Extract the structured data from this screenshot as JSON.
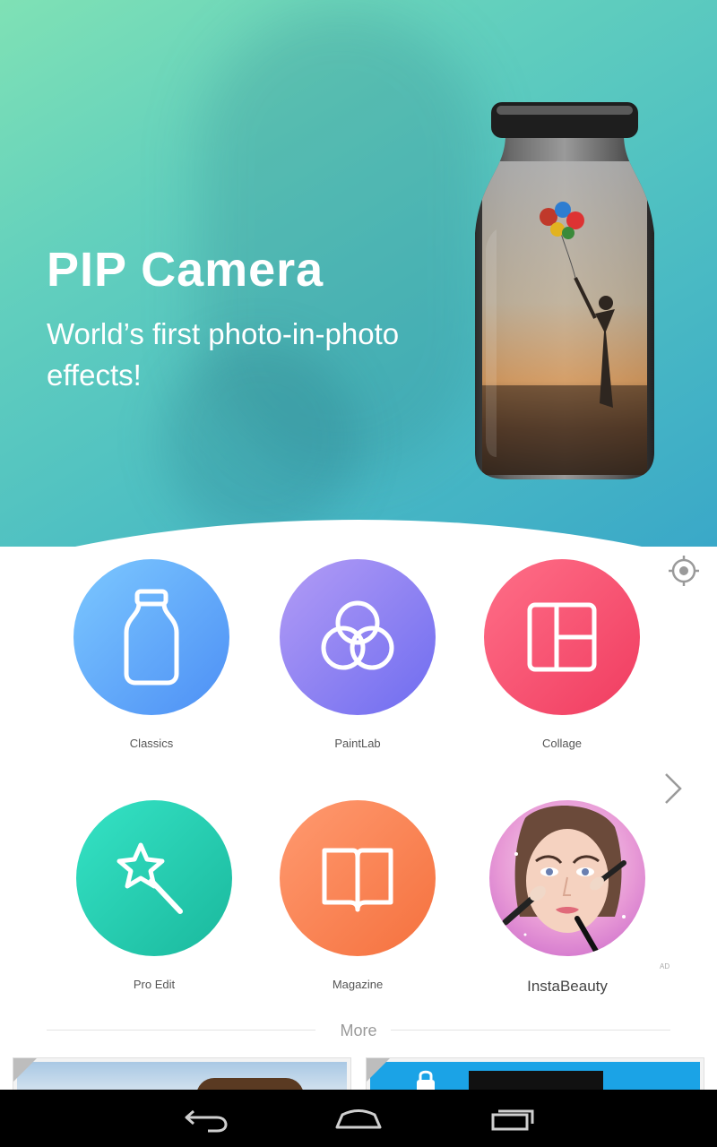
{
  "hero": {
    "title": "PIP Camera",
    "subtitle": "World’s first photo-in-photo effects!"
  },
  "features": [
    {
      "label": "Classics",
      "icon": "bottle-icon",
      "color_from": "#7cc8ff",
      "color_to": "#4d8ff5"
    },
    {
      "label": "PaintLab",
      "icon": "circles-icon",
      "color_from": "#b39cf5",
      "color_to": "#6e6cf0"
    },
    {
      "label": "Collage",
      "icon": "collage-grid-icon",
      "color_from": "#ff6f88",
      "color_to": "#f03c60"
    },
    {
      "label": "Pro Edit",
      "icon": "magic-wand-icon",
      "color_from": "#35e3c5",
      "color_to": "#1ab89d"
    },
    {
      "label": "Magazine",
      "icon": "open-book-icon",
      "color_from": "#ff9a70",
      "color_to": "#f5713e"
    },
    {
      "label": "InstaBeauty",
      "icon": "beauty-face-image"
    }
  ],
  "ad_badge": "AD",
  "more": {
    "label": "More"
  },
  "nav": {
    "back": "back-icon",
    "home": "home-icon",
    "recents": "recents-icon"
  }
}
